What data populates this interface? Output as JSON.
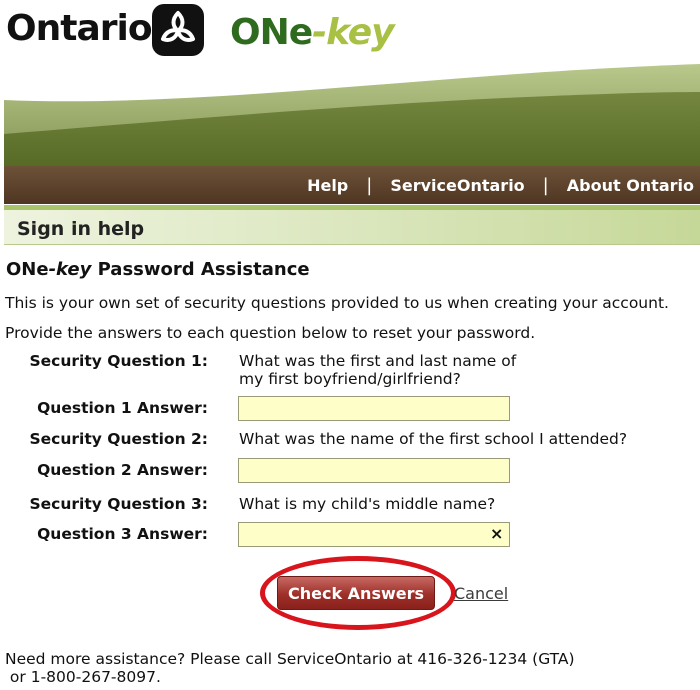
{
  "header": {
    "ontario_logo": "Ontario",
    "onekey_prefix": "ONe",
    "onekey_suffix": "-key"
  },
  "nav": {
    "help": "Help",
    "sep1": "|",
    "serviceontario": "ServiceOntario",
    "sep2": "|",
    "about": "About Ontario"
  },
  "section": {
    "title": "Sign in help"
  },
  "page": {
    "title_prefix": "ONe",
    "title_key": "-key",
    "title_rest": " Password Assistance",
    "intro1": "This is your own set of security questions provided to us when creating your account.",
    "intro2": "Provide the answers to each question below to reset your password."
  },
  "form": {
    "q1_label": "Security Question 1:",
    "q1_line1": "What was the first and last name of",
    "q1_line2": "my first boyfriend/girlfriend?",
    "a1_label": "Question 1 Answer:",
    "a1_value": "",
    "q2_label": "Security Question 2:",
    "q2_text": "What was the name of the first school I attended?",
    "a2_label": "Question 2 Answer:",
    "a2_value": "",
    "q3_label": "Security Question 3:",
    "q3_text": "What is my child's middle name?",
    "a3_label": "Question 3 Answer:",
    "a3_value": "",
    "a3_clear": "×"
  },
  "actions": {
    "check": "Check Answers",
    "cancel": "Cancel"
  },
  "footer": {
    "line1": "Need more assistance? Please call ServiceOntario at 416-326-1234 (GTA)",
    "line2": " or 1-800-267-8097."
  },
  "colors": {
    "nav_bg": "#5b4029",
    "brand_green": "#2f6b1f",
    "key_green": "#a8c043",
    "input_bg": "#fefec8",
    "button_red": "#9e2f29",
    "highlight_ring": "#d8141c"
  }
}
